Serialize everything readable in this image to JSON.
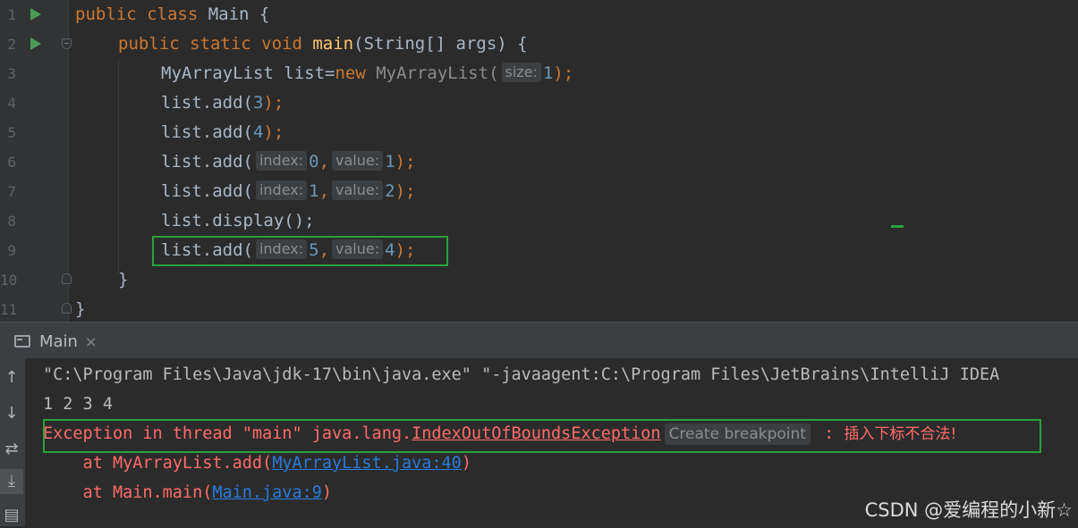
{
  "editor": {
    "line_numbers": [
      "1",
      "2",
      "3",
      "4",
      "5",
      "6",
      "7",
      "8",
      "9",
      "10",
      "11"
    ],
    "lines": {
      "l1": {
        "kw1": "public class",
        "rest": " Main {"
      },
      "l2": {
        "kw1": "public static void",
        "fn": "main",
        "rest": "(String[] args) {"
      },
      "l3": {
        "a": "MyArrayList list=",
        "kw": "new",
        "b": " MyArrayList(",
        "hint": "size:",
        "num": "1",
        "c": ");"
      },
      "l4": {
        "a": "list.add(",
        "num": "3",
        "b": ");"
      },
      "l5": {
        "a": "list.add(",
        "num": "4",
        "b": ");"
      },
      "l6": {
        "a": "list.add(",
        "hint1": "index:",
        "num1": "0",
        "sep": ",",
        "hint2": "value:",
        "num2": "1",
        "b": ");"
      },
      "l7": {
        "a": "list.add(",
        "hint1": "index:",
        "num1": "1",
        "sep": ",",
        "hint2": "value:",
        "num2": "2",
        "b": ");"
      },
      "l8": {
        "a": "list.display();"
      },
      "l9": {
        "a": "list.add(",
        "hint1": "index:",
        "num1": "5",
        "sep": ",",
        "hint2": "value:",
        "num2": "4",
        "b": ");"
      },
      "l10": {
        "a": "}"
      },
      "l11": {
        "a": "}"
      }
    }
  },
  "tool_window": {
    "tab_label": "Main",
    "close_glyph": "×"
  },
  "console": {
    "command": "\"C:\\Program Files\\Java\\jdk-17\\bin\\java.exe\" \"-javaagent:C:\\Program Files\\JetBrains\\IntelliJ IDEA",
    "output": "1 2 3 4",
    "exception_prefix": "Exception in thread \"main\" java.lang.",
    "exception_class": "IndexOutOfBoundsException",
    "breakpoint_hint": "Create breakpoint",
    "exception_message_sep": " : ",
    "exception_message": "插入下标不合法!",
    "trace1_prefix": "    at MyArrayList.add(",
    "trace1_link": "MyArrayList.java:40",
    "trace1_suffix": ")",
    "trace2_prefix": "    at Main.main(",
    "trace2_link": "Main.java:9",
    "trace2_suffix": ")"
  },
  "sidebar_icons": [
    "arrow-up-icon",
    "arrow-down-icon",
    "soft-wrap-icon",
    "scroll-to-end-icon",
    "print-icon"
  ],
  "sidebar_glyphs": {
    "up": "↑",
    "down": "↓",
    "wrap": "⇄",
    "end": "⤓",
    "print": "▤"
  },
  "watermark": "CSDN @爱编程的小新☆",
  "colors": {
    "keyword": "#cc7832",
    "function": "#ffc66d",
    "number": "#6897bb",
    "error": "#ff6b68",
    "link": "#287bde",
    "highlight_box": "#27a33a"
  }
}
